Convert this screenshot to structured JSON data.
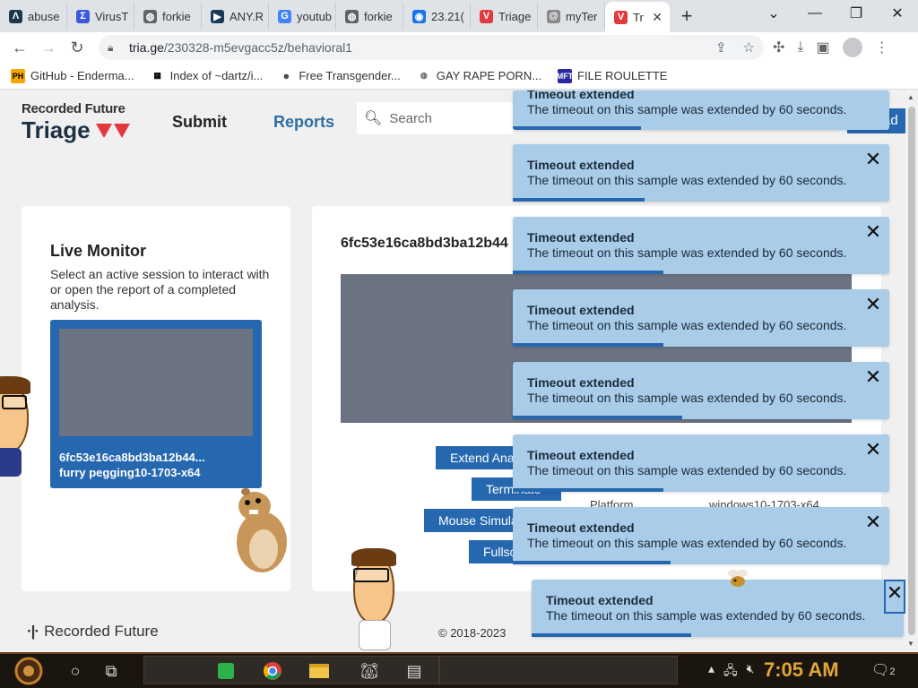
{
  "browser": {
    "tabs": [
      {
        "label": "abuse",
        "icon": "abuse-icon",
        "color": "#1a3a4a",
        "glyph": "Λ"
      },
      {
        "label": "VirusT",
        "icon": "virustotal-icon",
        "color": "#3b5bdb",
        "glyph": "Σ"
      },
      {
        "label": "forkie",
        "icon": "globe-icon",
        "color": "#5f6368",
        "glyph": "◍"
      },
      {
        "label": "ANY.R",
        "icon": "anyrun-icon",
        "color": "#1b3a5a",
        "glyph": "▶"
      },
      {
        "label": "youtub",
        "icon": "google-icon",
        "color": "#4285f4",
        "glyph": "G"
      },
      {
        "label": "forkie",
        "icon": "globe-icon",
        "color": "#5f6368",
        "glyph": "◍"
      },
      {
        "label": "23.21(",
        "icon": "location-icon",
        "color": "#1a73e8",
        "glyph": "◉"
      },
      {
        "label": "Triage",
        "icon": "triage-icon",
        "color": "#e2393f",
        "glyph": "V"
      },
      {
        "label": "myTer",
        "icon": "at-icon",
        "color": "#888888",
        "glyph": "@"
      }
    ],
    "active_tab": {
      "label": "Tr",
      "icon": "triage-icon",
      "close": "✕"
    },
    "new_tab": "+",
    "window_controls": {
      "dropdown": "⌄",
      "minimize": "—",
      "restore": "❐",
      "close": "✕"
    },
    "url_host": "tria.ge",
    "url_path": "/230328-m5evgacc5z/behavioral1",
    "bookmarks": [
      {
        "label": "GitHub - Enderma...",
        "icon": "ph-icon",
        "glyph": "PH",
        "bg": "#f7a700",
        "fg": "#000000"
      },
      {
        "label": "Index of ~dartz/i...",
        "icon": "qr-icon",
        "glyph": "▦",
        "bg": "#ffffff",
        "fg": "#000000"
      },
      {
        "label": "Free Transgender...",
        "icon": "mask-icon",
        "glyph": "☻",
        "bg": "#ffffff",
        "fg": "#333333"
      },
      {
        "label": "GAY RAPE PORN...",
        "icon": "globe-icon",
        "glyph": "◍",
        "bg": "#ffffff",
        "fg": "#5f6368"
      },
      {
        "label": "FILE ROULETTE",
        "icon": "file-roulette-icon",
        "glyph": "MFT",
        "bg": "#2a2aa0",
        "fg": "#ffffff"
      }
    ]
  },
  "site": {
    "brand_top": "Recorded Future",
    "brand_main": "Triage",
    "nav_submit": "Submit",
    "nav_reports": "Reports",
    "search_placeholder": "Search",
    "login_partial": "ad",
    "accent": "#2568b0",
    "brand_red": "#e2393f"
  },
  "live_monitor": {
    "title": "Live Monitor",
    "description": "Select an active session to interact with or open the report of a completed analysis.",
    "session_id": "6fc53e16ca8bd3ba12b44...",
    "session_tag": "furry pegging10-1703-x64"
  },
  "detail": {
    "hash": "6fc53e16ca8bd3ba12b44",
    "buttons": [
      "Extend Analysis",
      "Terminate",
      "Mouse Simulation",
      "Fullscreen"
    ],
    "platform_label": "Platform",
    "platform_value": "windows10-1703-x64"
  },
  "footer": {
    "logo": "Recorded Future",
    "copyright": "© 2018-2023"
  },
  "toasts": [
    {
      "title": "Timeout extended",
      "message": "The timeout on this sample was extended by 60 seconds.",
      "progress": 0.34
    },
    {
      "title": "Timeout extended",
      "message": "The timeout on this sample was extended by 60 seconds.",
      "progress": 0.35
    },
    {
      "title": "Timeout extended",
      "message": "The timeout on this sample was extended by 60 seconds.",
      "progress": 0.4
    },
    {
      "title": "Timeout extended",
      "message": "The timeout on this sample was extended by 60 seconds.",
      "progress": 0.4
    },
    {
      "title": "Timeout extended",
      "message": "The timeout on this sample was extended by 60 seconds.",
      "progress": 0.45
    },
    {
      "title": "Timeout extended",
      "message": "The timeout on this sample was extended by 60 seconds.",
      "progress": 0.4
    },
    {
      "title": "Timeout extended",
      "message": "The timeout on this sample was extended by 60 seconds.",
      "progress": 0.42
    },
    {
      "title": "Timeout extended",
      "message": "The timeout on this sample was extended by 60 seconds.",
      "progress": 0.43
    }
  ],
  "toast_close": "✕",
  "taskbar": {
    "clock": "7:05 AM",
    "notification_count": "2"
  }
}
